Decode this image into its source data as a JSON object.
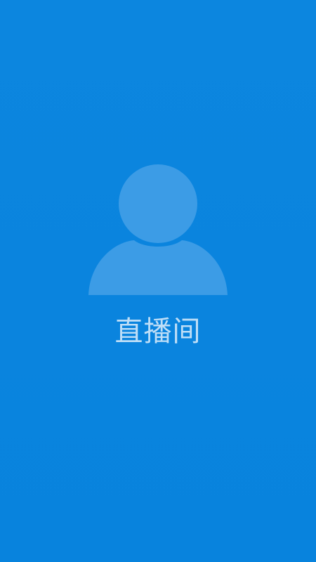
{
  "screen": {
    "title": "直播间",
    "avatar_icon": "user-placeholder-icon",
    "background_color": "#0A84DE",
    "icon_color": "#3C9CE6"
  }
}
